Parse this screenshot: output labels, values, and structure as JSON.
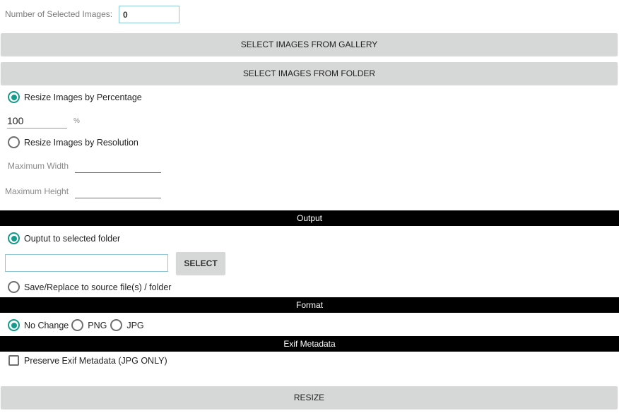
{
  "selection": {
    "count_label": "Number of Selected Images:",
    "count_value": "0",
    "gallery_button": "SELECT IMAGES FROM GALLERY",
    "folder_button": "SELECT IMAGES FROM FOLDER"
  },
  "resize": {
    "by_percentage_label": "Resize Images by Percentage",
    "by_percentage_selected": true,
    "percentage_value": "100",
    "percentage_unit": "%",
    "by_resolution_label": "Resize Images by Resolution",
    "by_resolution_selected": false,
    "max_width_label": "Maximum Width",
    "max_width_value": "",
    "max_height_label": "Maximum Height",
    "max_height_value": ""
  },
  "output": {
    "header": "Output",
    "to_folder_label": "Ouptut to selected folder",
    "to_folder_selected": true,
    "folder_path_value": "",
    "select_button": "SELECT",
    "replace_label": "Save/Replace to source file(s) / folder",
    "replace_selected": false
  },
  "format": {
    "header": "Format",
    "options": [
      {
        "label": "No Change",
        "selected": true
      },
      {
        "label": "PNG",
        "selected": false
      },
      {
        "label": "JPG",
        "selected": false
      }
    ]
  },
  "exif": {
    "header": "Exif Metadata",
    "preserve_label": "Preserve Exif Metadata (JPG ONLY)",
    "preserve_checked": false
  },
  "actions": {
    "resize_button": "RESIZE"
  },
  "colors": {
    "accent": "#139b8c",
    "button_bg": "#d6d7d7",
    "section_bar_bg": "#000000",
    "input_border": "#8fc7d6"
  }
}
